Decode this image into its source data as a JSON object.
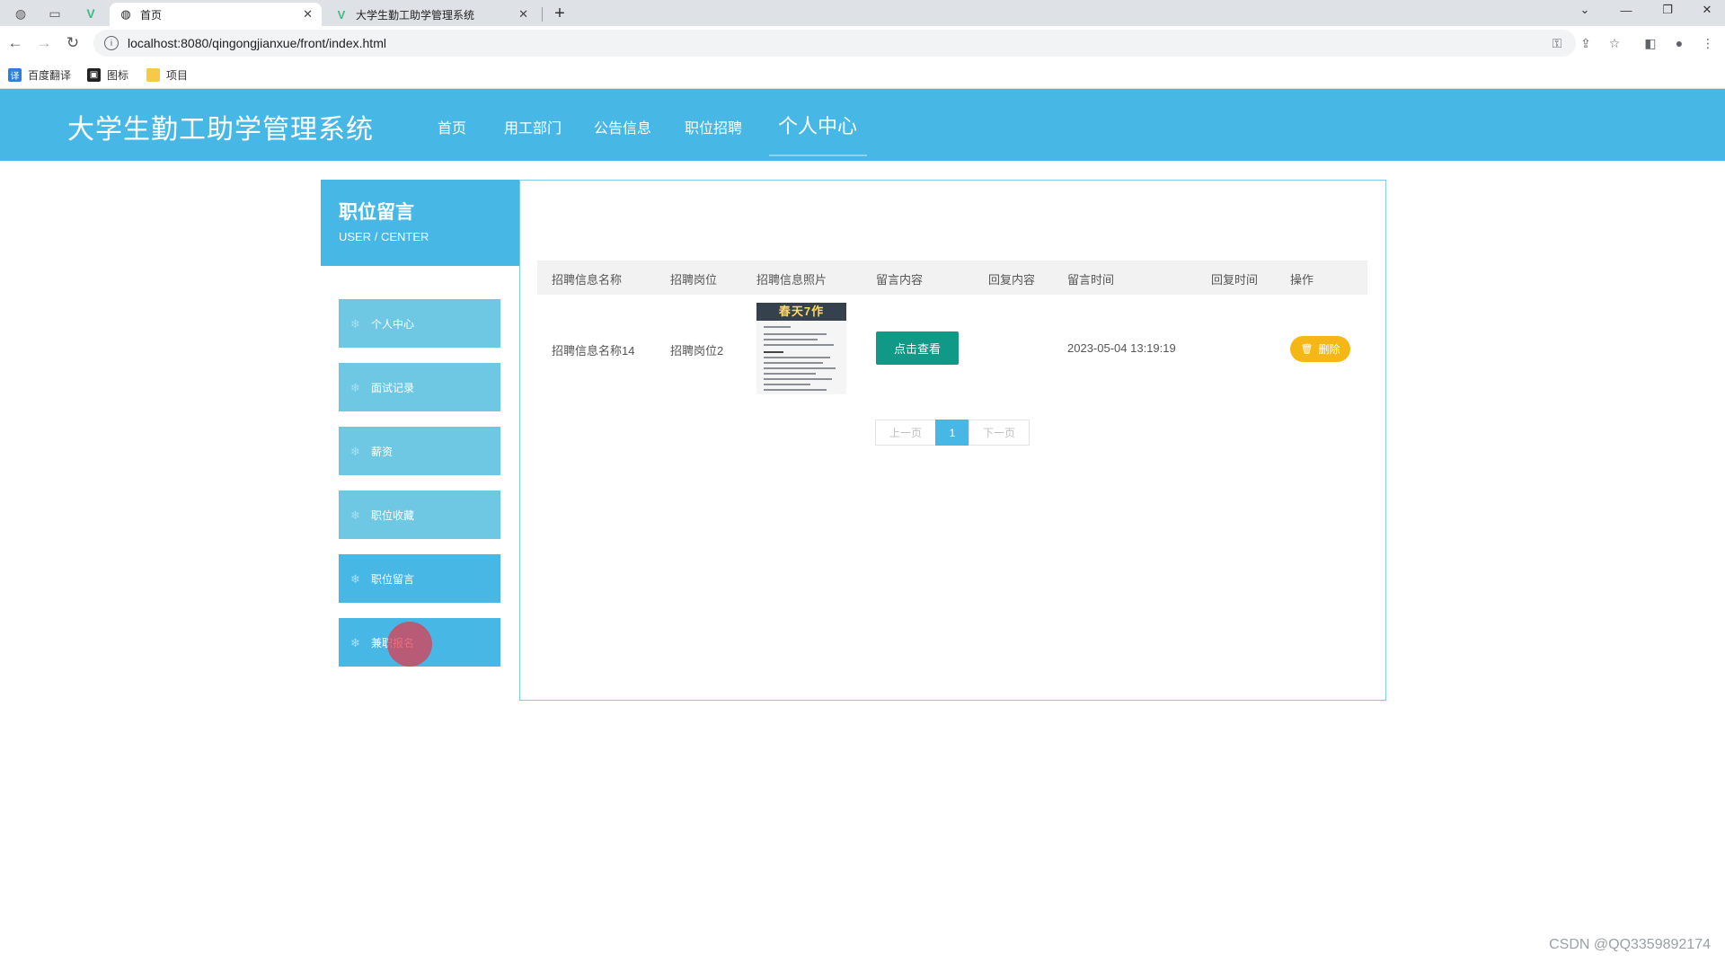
{
  "browser": {
    "tabs": [
      {
        "label": "首页",
        "active": true
      },
      {
        "label": "大学生勤工助学管理系统",
        "active": false
      }
    ],
    "url": "localhost:8080/qingongjianxue/front/index.html",
    "bookmarks": [
      "百度翻译",
      "图标",
      "项目"
    ]
  },
  "site": {
    "title": "大学生勤工助学管理系统",
    "nav": [
      "首页",
      "用工部门",
      "公告信息",
      "职位招聘",
      "个人中心"
    ],
    "active_nav": "个人中心"
  },
  "sidebar": {
    "title": "职位留言",
    "subtitle": "USER / CENTER",
    "items": [
      {
        "label": "个人中心"
      },
      {
        "label": "面试记录"
      },
      {
        "label": "薪资"
      },
      {
        "label": "职位收藏"
      },
      {
        "label": "职位留言"
      },
      {
        "label": "兼职报名"
      }
    ],
    "active_item": "职位留言"
  },
  "table": {
    "headers": [
      "招聘信息名称",
      "招聘岗位",
      "招聘信息照片",
      "留言内容",
      "回复内容",
      "留言时间",
      "回复时间",
      "操作"
    ],
    "rows": [
      {
        "name": "招聘信息名称14",
        "position": "招聘岗位2",
        "photo_caption": "春天7作",
        "content_button": "点击查看",
        "reply": "",
        "time": "2023-05-04 13:19:19",
        "reply_time": "",
        "delete_label": "删除"
      }
    ]
  },
  "pagination": {
    "prev": "上一页",
    "current": "1",
    "next": "下一页"
  },
  "watermark": "CSDN @QQ3359892174",
  "colors": {
    "primary": "#47b8e6",
    "sidebar_item": "#6ec8e3",
    "view_button": "#119988",
    "delete_button": "#f5b716"
  }
}
